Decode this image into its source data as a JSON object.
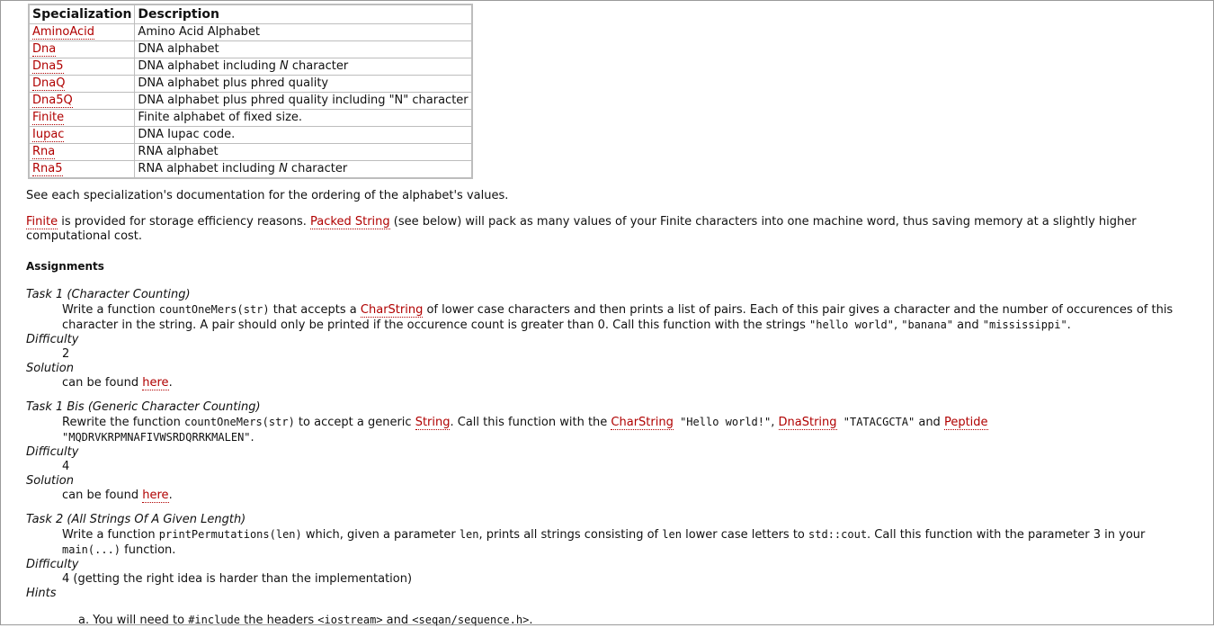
{
  "table": {
    "headers": [
      "Specialization",
      "Description"
    ],
    "rows": [
      {
        "name": "AminoAcid",
        "desc": "Amino Acid Alphabet"
      },
      {
        "name": "Dna",
        "desc": "DNA alphabet"
      },
      {
        "name": "Dna5",
        "desc_pre": "DNA alphabet including ",
        "desc_em": "N",
        "desc_post": " character"
      },
      {
        "name": "DnaQ",
        "desc": "DNA alphabet plus phred quality"
      },
      {
        "name": "Dna5Q",
        "desc": "DNA alphabet plus phred quality including \"N\" character"
      },
      {
        "name": "Finite",
        "desc": "Finite alphabet of fixed size."
      },
      {
        "name": "Iupac",
        "desc": "DNA Iupac code."
      },
      {
        "name": "Rna",
        "desc": "RNA alphabet"
      },
      {
        "name": "Rna5",
        "desc_pre": "RNA alphabet including ",
        "desc_em": "N",
        "desc_post": " character"
      }
    ]
  },
  "para1": "See each specialization's documentation for the ordering of the alphabet's values.",
  "para2": {
    "link1": "Finite",
    "text1": " is provided for storage efficiency reasons. ",
    "link2": "Packed String",
    "text2": " (see below) will pack as many values of your Finite characters into one machine word, thus saving memory at a slightly higher computational cost."
  },
  "assignments_heading": "Assignments",
  "task1": {
    "title": "Task 1 (Character Counting)",
    "d1": "Write a function ",
    "c1": "countOneMers(str)",
    "d2": " that accepts a ",
    "l1": "CharString",
    "d3": " of lower case characters and then prints a list of pairs. Each of this pair gives a character and the number of occurences of this character in the string. A pair should only be printed if the occurence count is greater than 0. Call this function with the strings ",
    "c2": "\"hello world\"",
    "d4": ", ",
    "c3": "\"banana\"",
    "d5": " and ",
    "c4": "\"mississippi\"",
    "d6": ".",
    "difficulty_label": "Difficulty",
    "difficulty": "2",
    "solution_label": "Solution",
    "solution_pre": "can be found ",
    "solution_link": "here",
    "solution_post": "."
  },
  "task1bis": {
    "title": "Task 1 Bis (Generic Character Counting)",
    "d1": "Rewrite the function ",
    "c1": "countOneMers(str)",
    "d2": " to accept a generic ",
    "l1": "String",
    "d3": ". Call this function with the ",
    "l2": "CharString",
    "c2": " \"Hello world!\"",
    "d4": ", ",
    "l3": "DnaString",
    "c3": " \"TATACGCTA\"",
    "d5": " and ",
    "l4": "Peptide",
    "c4": "\"MQDRVKRPMNAFIVWSRDQRRKMALEN\"",
    "d6": ".",
    "difficulty_label": "Difficulty",
    "difficulty": "4",
    "solution_label": "Solution",
    "solution_pre": "can be found ",
    "solution_link": "here",
    "solution_post": "."
  },
  "task2": {
    "title": "Task 2 (All Strings Of A Given Length)",
    "d1": "Write a function ",
    "c1": "printPermutations(len)",
    "d2": " which, given a parameter ",
    "c2": "len",
    "d3": ", prints all strings consisting of ",
    "c3": "len",
    "d4": " lower case letters to ",
    "c4": "std::cout",
    "d5": ". Call this function with the parameter 3 in your ",
    "c5": "main(...)",
    "d6": " function.",
    "difficulty_label": "Difficulty",
    "difficulty": "4 (getting the right idea is harder than the implementation)",
    "hints_label": "Hints",
    "hint_a_marker": "a.",
    "hint_a_pre": " You will need to ",
    "hint_a_c1": "#include",
    "hint_a_mid": " the headers ",
    "hint_a_c2": "<iostream>",
    "hint_a_and": " and ",
    "hint_a_c3": "<seqan/sequence.h>",
    "hint_a_post": "."
  }
}
